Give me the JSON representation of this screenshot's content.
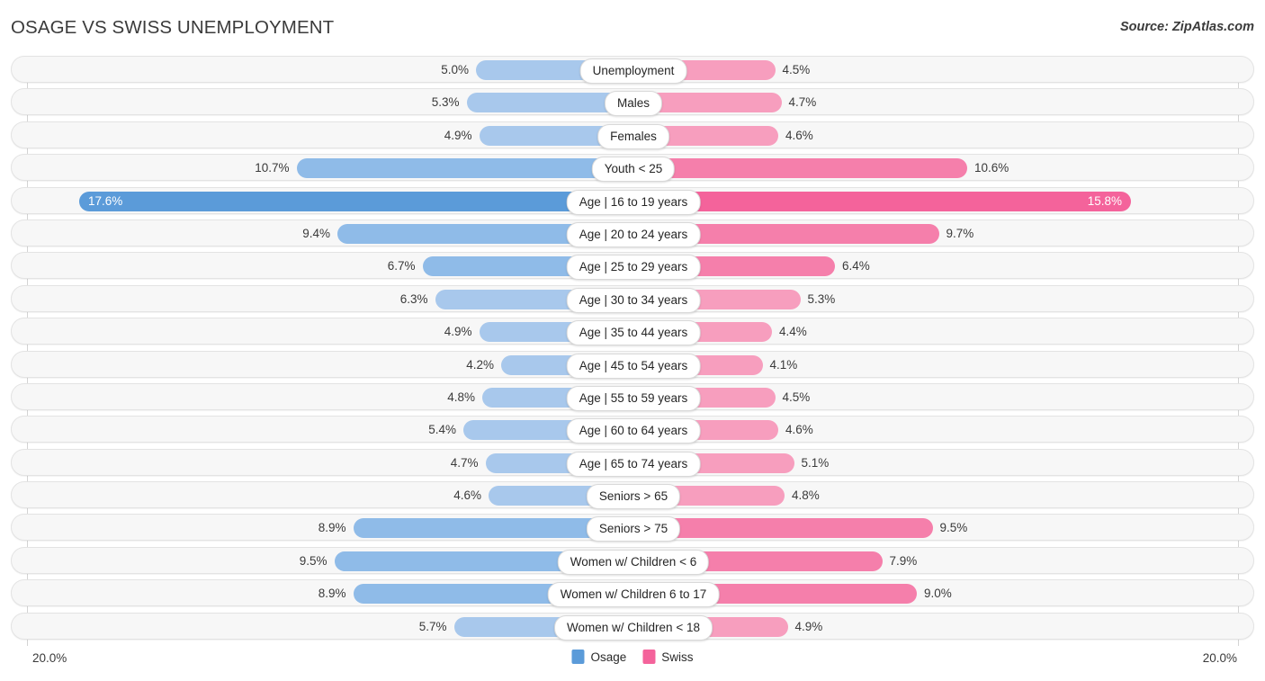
{
  "header": {
    "title": "OSAGE VS SWISS UNEMPLOYMENT",
    "source": "Source: ZipAtlas.com"
  },
  "footer": {
    "axis_min_label": "20.0%",
    "axis_max_label": "20.0%",
    "legend": [
      {
        "label": "Osage",
        "color": "#5b9bd9",
        "swatch": "osage"
      },
      {
        "label": "Swiss",
        "color": "#f4639b",
        "swatch": "swiss"
      }
    ]
  },
  "axis": {
    "max_value": 20.0,
    "left_color_light": "#a8c8ec",
    "left_color_dark": "#5b9bd9",
    "right_color_light": "#f79ebe",
    "right_color_dark": "#f4639b"
  },
  "chart_data": {
    "type": "bar",
    "title": "OSAGE VS SWISS UNEMPLOYMENT",
    "subtitle": "",
    "xlabel": "",
    "ylabel": "",
    "orientation": "horizontal-diverging",
    "axis_max": 20.0,
    "xlim": [
      20.0,
      20.0
    ],
    "grid": false,
    "legend_position": "bottom-center",
    "categories": [
      "Unemployment",
      "Males",
      "Females",
      "Youth < 25",
      "Age | 16 to 19 years",
      "Age | 20 to 24 years",
      "Age | 25 to 29 years",
      "Age | 30 to 34 years",
      "Age | 35 to 44 years",
      "Age | 45 to 54 years",
      "Age | 55 to 59 years",
      "Age | 60 to 64 years",
      "Age | 65 to 74 years",
      "Seniors > 65",
      "Seniors > 75",
      "Women w/ Children < 6",
      "Women w/ Children 6 to 17",
      "Women w/ Children < 18"
    ],
    "series": [
      {
        "name": "Osage",
        "side": "left",
        "color": "#a8c8ec",
        "values": [
          5.0,
          5.3,
          4.9,
          10.7,
          17.6,
          9.4,
          6.7,
          6.3,
          4.9,
          4.2,
          4.8,
          5.4,
          4.7,
          4.6,
          8.9,
          9.5,
          8.9,
          5.7
        ]
      },
      {
        "name": "Swiss",
        "side": "right",
        "color": "#f79ebe",
        "values": [
          4.5,
          4.7,
          4.6,
          10.6,
          15.8,
          9.7,
          6.4,
          5.3,
          4.4,
          4.1,
          4.5,
          4.6,
          5.1,
          4.8,
          9.5,
          7.9,
          9.0,
          4.9
        ]
      }
    ]
  },
  "rows": [
    {
      "label": "Unemployment",
      "left": "5.0%",
      "right": "4.5%",
      "left_val": 5.0,
      "right_val": 4.5,
      "style": "normal"
    },
    {
      "label": "Males",
      "left": "5.3%",
      "right": "4.7%",
      "left_val": 5.3,
      "right_val": 4.7,
      "style": "normal"
    },
    {
      "label": "Females",
      "left": "4.9%",
      "right": "4.6%",
      "left_val": 4.9,
      "right_val": 4.6,
      "style": "normal"
    },
    {
      "label": "Youth < 25",
      "left": "10.7%",
      "right": "10.6%",
      "left_val": 10.7,
      "right_val": 10.6,
      "style": "mid"
    },
    {
      "label": "Age | 16 to 19 years",
      "left": "17.6%",
      "right": "15.8%",
      "left_val": 17.6,
      "right_val": 15.8,
      "style": "highlight"
    },
    {
      "label": "Age | 20 to 24 years",
      "left": "9.4%",
      "right": "9.7%",
      "left_val": 9.4,
      "right_val": 9.7,
      "style": "mid"
    },
    {
      "label": "Age | 25 to 29 years",
      "left": "6.7%",
      "right": "6.4%",
      "left_val": 6.7,
      "right_val": 6.4,
      "style": "mid"
    },
    {
      "label": "Age | 30 to 34 years",
      "left": "6.3%",
      "right": "5.3%",
      "left_val": 6.3,
      "right_val": 5.3,
      "style": "normal"
    },
    {
      "label": "Age | 35 to 44 years",
      "left": "4.9%",
      "right": "4.4%",
      "left_val": 4.9,
      "right_val": 4.4,
      "style": "normal"
    },
    {
      "label": "Age | 45 to 54 years",
      "left": "4.2%",
      "right": "4.1%",
      "left_val": 4.2,
      "right_val": 4.1,
      "style": "normal"
    },
    {
      "label": "Age | 55 to 59 years",
      "left": "4.8%",
      "right": "4.5%",
      "left_val": 4.8,
      "right_val": 4.5,
      "style": "normal"
    },
    {
      "label": "Age | 60 to 64 years",
      "left": "5.4%",
      "right": "4.6%",
      "left_val": 5.4,
      "right_val": 4.6,
      "style": "normal"
    },
    {
      "label": "Age | 65 to 74 years",
      "left": "4.7%",
      "right": "5.1%",
      "left_val": 4.7,
      "right_val": 5.1,
      "style": "normal"
    },
    {
      "label": "Seniors > 65",
      "left": "4.6%",
      "right": "4.8%",
      "left_val": 4.6,
      "right_val": 4.8,
      "style": "normal"
    },
    {
      "label": "Seniors > 75",
      "left": "8.9%",
      "right": "9.5%",
      "left_val": 8.9,
      "right_val": 9.5,
      "style": "mid"
    },
    {
      "label": "Women w/ Children < 6",
      "left": "9.5%",
      "right": "7.9%",
      "left_val": 9.5,
      "right_val": 7.9,
      "style": "mid"
    },
    {
      "label": "Women w/ Children 6 to 17",
      "left": "8.9%",
      "right": "9.0%",
      "left_val": 8.9,
      "right_val": 9.0,
      "style": "mid"
    },
    {
      "label": "Women w/ Children < 18",
      "left": "5.7%",
      "right": "4.9%",
      "left_val": 5.7,
      "right_val": 4.9,
      "style": "normal"
    }
  ]
}
